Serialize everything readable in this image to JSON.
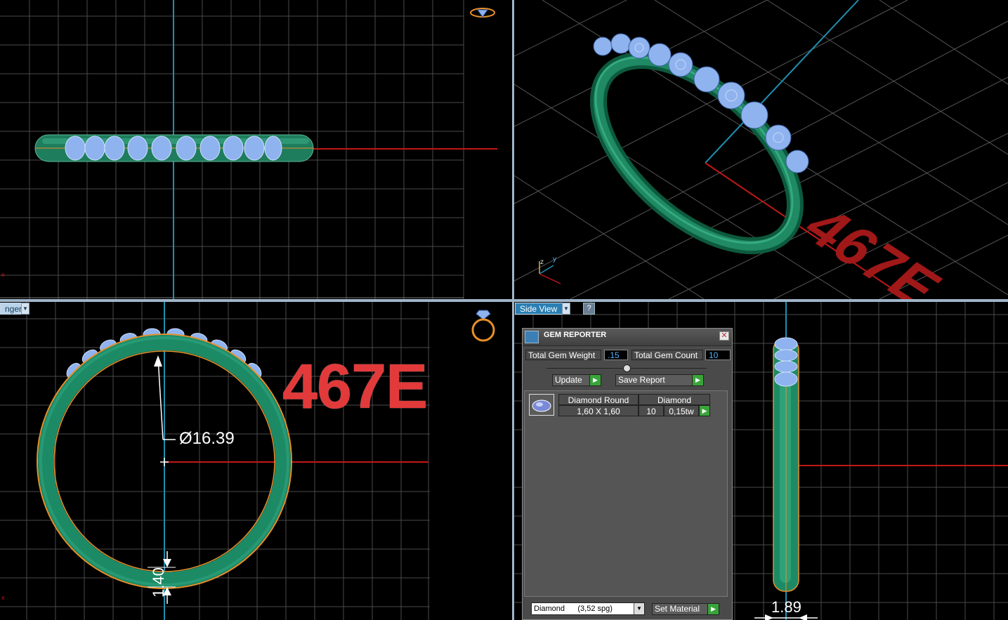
{
  "viewports": {
    "top_left": {
      "name": "front-view"
    },
    "top_right": {
      "name": "perspective-view",
      "axis_labels": {
        "z": "z",
        "y": "y"
      }
    },
    "bottom_left": {
      "label": "nger",
      "dimension_diameter": "Ø16.39",
      "dimension_thickness": "1.40",
      "stamp": "467E"
    },
    "bottom_right": {
      "label": "Side View",
      "dimension_width": "1.89"
    }
  },
  "stamp_perspective": "467E",
  "gem_reporter": {
    "title": "GEM REPORTER",
    "close_symbol": "✕",
    "total_gem_weight_label": "Total Gem Weight",
    "total_gem_weight_value": ".15",
    "total_gem_count_label": "Total Gem Count",
    "total_gem_count_value": "10",
    "update_label": "Update",
    "save_report_label": "Save Report",
    "rows": [
      {
        "shape": "Diamond Round",
        "size": "1,60 X 1,60",
        "material": "Diamond",
        "count": "10",
        "weight": "0,15tw"
      }
    ],
    "material_select": {
      "value": "Diamond      (3,52 spg)"
    },
    "set_material_label": "Set Material"
  },
  "colors": {
    "grid": "#4d4d4d",
    "band": "#1f8a64",
    "gem": "#8fb3ef",
    "axis_red": "#c01818",
    "axis_cyan": "#1f8fb0",
    "outline_orange": "#e8902a",
    "stamp_red": "#e23a3a"
  }
}
